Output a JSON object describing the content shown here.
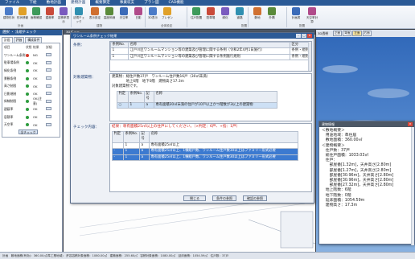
{
  "menubar": {
    "tabs": [
      "ファイル",
      "下絵",
      "敷地計画",
      "建物計画",
      "概要算定",
      "事業収支",
      "プラン図",
      "CAD機能"
    ],
    "active": 3
  },
  "ribbon": {
    "buttons": [
      "建物形状",
      "形状移動",
      "面積確認",
      "建蔽率",
      "容積率表示",
      "法規チェック",
      "表示設定",
      "高度斜線",
      "天空率",
      "日影",
      "3D表示",
      "プレゼン",
      "住戸配置",
      "駐車場",
      "緑化",
      "道路",
      "敷地",
      "外構",
      "計画書",
      "天空率計算"
    ],
    "groups": [
      "計画",
      "建物",
      "全体設定",
      "配置",
      "配置"
    ]
  },
  "left_panel": {
    "title": "選択 ・ 法規チェック",
    "tabs": [
      "計画",
      "評価",
      "構成条件"
    ],
    "headers": [
      "項目",
      "状態",
      "結果",
      "詳細"
    ],
    "rows": [
      {
        "name": "ワンルーム条例",
        "status": "ng",
        "result": "NG"
      },
      {
        "name": "駐車場条例",
        "status": "ok",
        "result": "OK"
      },
      {
        "name": "緑化条例",
        "status": "ok",
        "result": "OK"
      },
      {
        "name": "景観条例",
        "status": "ok",
        "result": "OK"
      },
      {
        "name": "高さ制限",
        "status": "ok",
        "result": "OK"
      },
      {
        "name": "日影規制",
        "status": "ok",
        "result": "OK"
      },
      {
        "name": "斜線制限",
        "status": "ok",
        "result": "OK(注意)"
      },
      {
        "name": "建蔽率",
        "status": "ok",
        "result": "OK"
      },
      {
        "name": "容積率",
        "status": "ok",
        "result": "OK"
      },
      {
        "name": "天空率",
        "status": "ok",
        "result": "OK"
      }
    ],
    "check_button": "全チェック"
  },
  "viewport": {
    "title": "3Dビュー"
  },
  "right_view": {
    "label": "3D透視",
    "buttons": [
      "正面",
      "背面",
      "左面",
      "右面"
    ]
  },
  "dialog": {
    "title": "ワンルーム条例チェック結果",
    "jorei_label": "条例：",
    "jorei_headers": [
      "条例No.",
      "名称",
      "区分"
    ],
    "jorei_rows": [
      {
        "no": "1",
        "name": "江戸川区ワンルームマンション等の建築及び管理に関する条例（令和2年4月1日施行）",
        "kubun": "条例・規則"
      },
      {
        "no": "1",
        "name": "江戸川区ワンルームマンション等の建築及び管理に関する条例施行規則",
        "kubun": "条例・規則"
      }
    ],
    "target_label": "対象建築物：",
    "target_lines": [
      "建築物：総住戸数37戸　ワンルーム住戸数16戸（30㎡未満）",
      "　　　　地上6階　地下0階　建物高さ17.3m",
      "対象建築物です。"
    ],
    "criteria_headers": [
      "判定",
      "条例No.",
      "記号",
      "名称"
    ],
    "criteria_row": {
      "judge": "○",
      "no": "1",
      "mark": "a",
      "name": "専有面積30㎡未満の住戸が10戸以上かつ階数が3以上の建築物"
    },
    "check_label": "チェック内容：",
    "result_text": "結果：専有面積25㎡以上の住戸にしてください。（×判定：6戸、+指：1戸）",
    "result_headers": [
      "判定",
      "条例No.",
      "記号",
      "名称"
    ],
    "result_rows": [
      {
        "judge": "",
        "no": "1",
        "mark": "a",
        "name": "専有面積25㎡以上"
      },
      {
        "judge": "-",
        "no": "1",
        "mark": "a",
        "name": "専有面積25㎡以上、1棟総戸数、ワンルーム住戸数30以上はファミリー形式必要"
      },
      {
        "judge": "-",
        "no": "1",
        "mark": "a",
        "name": "専有面積25㎡以上、1棟総戸数、ワンルーム住戸数30以上はファミリー形式必要"
      }
    ],
    "buttons": [
      "閉じる",
      "条件の参照",
      "確認の参照"
    ]
  },
  "info": {
    "title": "建物情報",
    "lines": [
      "＜敷地概要＞",
      "　用途地域：準住居",
      "　敷地面積：360.00㎡",
      "＜建物概要＞",
      "　住戸数：37戸",
      "　総住戸面積：1033.03㎡",
      "　住戸：",
      "　　部屋番[1.32m]，天井高さ[2.80m]",
      "　　部屋番[1.27m]，天井高さ[2.80m]",
      "　　部屋番[30.96m]，天井高さ[2.80m]",
      "　　部屋番[30.96m]，天井高さ[2.80m]",
      "　　部屋番[27.32m]，天井高さ[2.80m]",
      "　地上階数：6階",
      "　地下階数：0階",
      "　延床面積：1054.59m",
      "　建物高さ：17.3m"
    ]
  },
  "statusbar": {
    "text": "計画　敷地面積(有効)：360.00㎡(準工業地域)　許容容積対象面積：1080.00㎡　建築面積：255.60㎡　容積対象面積：1080.00㎡　延床面積：1054.59㎡　住戸数：37戸"
  },
  "colors": {
    "title_bar": "#2b5a96",
    "ng": "#d43a2a",
    "ok": "#2e9c3e",
    "warning_text": "#d0201a"
  }
}
